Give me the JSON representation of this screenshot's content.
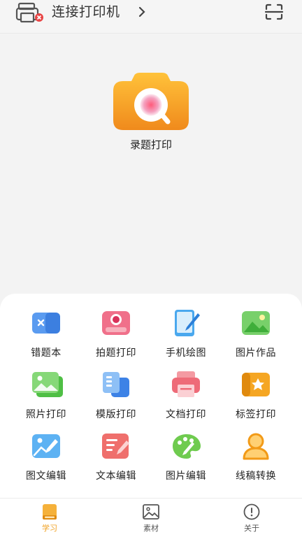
{
  "header": {
    "title": "连接打印机",
    "printer_icon": "printer-disconnected-icon",
    "scan_icon": "scan-icon"
  },
  "feature": {
    "label": "录题打印",
    "icon": "camera-icon"
  },
  "grid": [
    {
      "label": "错题本",
      "icon": "book-icon"
    },
    {
      "label": "拍题打印",
      "icon": "photo-print-icon"
    },
    {
      "label": "手机绘图",
      "icon": "tablet-draw-icon"
    },
    {
      "label": "图片作品",
      "icon": "image-icon"
    },
    {
      "label": "照片打印",
      "icon": "photo-icon"
    },
    {
      "label": "模版打印",
      "icon": "template-icon"
    },
    {
      "label": "文档打印",
      "icon": "document-print-icon"
    },
    {
      "label": "标签打印",
      "icon": "label-icon"
    },
    {
      "label": "图文编辑",
      "icon": "image-edit-icon"
    },
    {
      "label": "文本编辑",
      "icon": "text-edit-icon"
    },
    {
      "label": "图片编辑",
      "icon": "palette-icon"
    },
    {
      "label": "线稿转换",
      "icon": "person-outline-icon"
    }
  ],
  "tabs": [
    {
      "label": "学习",
      "icon": "book-tab-icon",
      "active": true
    },
    {
      "label": "素材",
      "icon": "image-tab-icon",
      "active": false
    },
    {
      "label": "关于",
      "icon": "info-tab-icon",
      "active": false
    }
  ],
  "colors": {
    "accent": "#f0a020",
    "blue": "#4a8fe8",
    "green": "#5cbf4a",
    "red": "#e8606a"
  }
}
